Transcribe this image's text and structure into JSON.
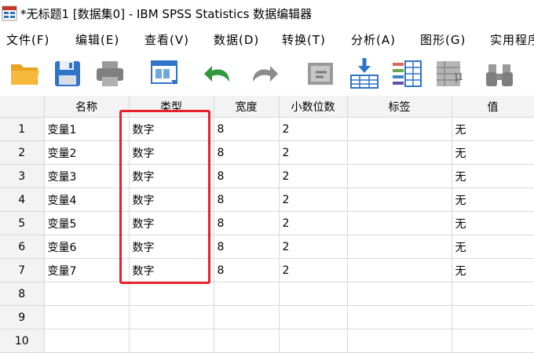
{
  "window": {
    "title": "*无标题1 [数据集0] - IBM SPSS Statistics 数据编辑器"
  },
  "menu": [
    "文件(F)",
    "编辑(E)",
    "查看(V)",
    "数据(D)",
    "转换(T)",
    "分析(A)",
    "图形(G)",
    "实用程序"
  ],
  "toolbar": {
    "icons": [
      "open-folder-icon",
      "save-icon",
      "print-icon",
      "dialog-recall-icon",
      "undo-icon",
      "redo-icon",
      "go-to-case-icon",
      "go-to-variable-icon",
      "variables-icon",
      "statistics-icon",
      "find-icon"
    ]
  },
  "columns": [
    "名称",
    "类型",
    "宽度",
    "小数位数",
    "标签",
    "值"
  ],
  "rows": [
    {
      "num": "1",
      "name": "变量1",
      "type": "数字",
      "width": "8",
      "decimals": "2",
      "label": "",
      "values": "无"
    },
    {
      "num": "2",
      "name": "变量2",
      "type": "数字",
      "width": "8",
      "decimals": "2",
      "label": "",
      "values": "无"
    },
    {
      "num": "3",
      "name": "变量3",
      "type": "数字",
      "width": "8",
      "decimals": "2",
      "label": "",
      "values": "无"
    },
    {
      "num": "4",
      "name": "变量4",
      "type": "数字",
      "width": "8",
      "decimals": "2",
      "label": "",
      "values": "无"
    },
    {
      "num": "5",
      "name": "变量5",
      "type": "数字",
      "width": "8",
      "decimals": "2",
      "label": "",
      "values": "无"
    },
    {
      "num": "6",
      "name": "变量6",
      "type": "数字",
      "width": "8",
      "decimals": "2",
      "label": "",
      "values": "无"
    },
    {
      "num": "7",
      "name": "变量7",
      "type": "数字",
      "width": "8",
      "decimals": "2",
      "label": "",
      "values": "无"
    },
    {
      "num": "8",
      "name": "",
      "type": "",
      "width": "",
      "decimals": "",
      "label": "",
      "values": ""
    },
    {
      "num": "9",
      "name": "",
      "type": "",
      "width": "",
      "decimals": "",
      "label": "",
      "values": ""
    },
    {
      "num": "10",
      "name": "",
      "type": "",
      "width": "",
      "decimals": "",
      "label": "",
      "values": ""
    }
  ],
  "colors": {
    "highlight": "#e8202a",
    "header_bg": "#f3f3f3"
  }
}
